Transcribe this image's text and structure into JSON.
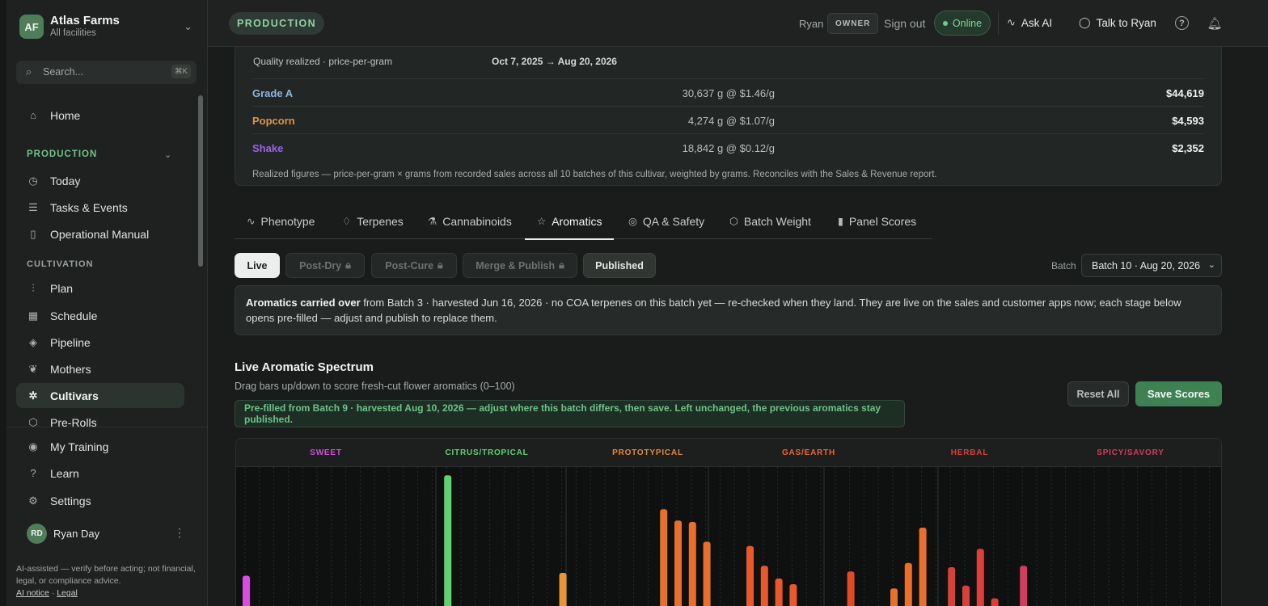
{
  "org": {
    "initials": "AF",
    "name": "Atlas Farms",
    "scope": "All facilities"
  },
  "search": {
    "placeholder": "Search...",
    "shortcut": "⌘K"
  },
  "nav": {
    "home": "Home",
    "production_section": "PRODUCTION",
    "today": "Today",
    "tasks": "Tasks & Events",
    "manual": "Operational Manual",
    "cultivation_section": "CULTIVATION",
    "plan": "Plan",
    "schedule": "Schedule",
    "pipeline": "Pipeline",
    "mothers": "Mothers",
    "cultivars": "Cultivars",
    "prerolls": "Pre-Rolls",
    "training": "My Training",
    "learn": "Learn",
    "settings": "Settings"
  },
  "user": {
    "initials": "RD",
    "name": "Ryan Day"
  },
  "disclaimer": {
    "text": "AI-assisted — verify before acting; not financial, legal, or compliance advice.",
    "ai_notice": "AI notice",
    "sep": "·",
    "legal": "Legal"
  },
  "topbar": {
    "context": "PRODUCTION",
    "user": "Ryan",
    "role": "OWNER",
    "signout": "Sign out",
    "status": "Online",
    "ask_ai": "Ask AI",
    "talk": "Talk to Ryan"
  },
  "revenue": {
    "header_label": "Quality realized · price-per-gram",
    "dates": "Oct 7, 2025 → Aug 20, 2026",
    "rows": [
      {
        "grade": "Grade A",
        "qty": "30,637 g @ $1.46/g",
        "total": "$44,619",
        "color": "#8fb6df"
      },
      {
        "grade": "Popcorn",
        "qty": "4,274 g @ $1.07/g",
        "total": "$4,593",
        "color": "#e0934a"
      },
      {
        "grade": "Shake",
        "qty": "18,842 g @ $0.12/g",
        "total": "$2,352",
        "color": "#9a63e8"
      }
    ],
    "note": "Realized figures — price-per-gram × grams from recorded sales across all 10 batches of this cultivar, weighted by grams. Reconciles with the Sales & Revenue report."
  },
  "tabs": [
    {
      "label": "Phenotype",
      "icon": "pulse-icon"
    },
    {
      "label": "Terpenes",
      "icon": "drop-icon"
    },
    {
      "label": "Cannabinoids",
      "icon": "flask-icon"
    },
    {
      "label": "Aromatics",
      "icon": "star-icon"
    },
    {
      "label": "QA & Safety",
      "icon": "check-circle-icon"
    },
    {
      "label": "Batch Weight",
      "icon": "box-icon"
    },
    {
      "label": "Panel Scores",
      "icon": "bar-chart-icon"
    }
  ],
  "stages": {
    "live": "Live",
    "postdry": "Post-Dry",
    "postcure": "Post-Cure",
    "merge": "Merge & Publish",
    "published": "Published"
  },
  "batch": {
    "label": "Batch",
    "selected": "Batch 10 · Aug 20, 2026"
  },
  "notice": {
    "bold": "Aromatics carried over",
    "text": " from Batch 3 · harvested Jun 16, 2026 · no COA terpenes on this batch yet — re-checked when they land. They are live on the sales and customer apps now; each stage below opens pre-filled — adjust and publish to replace them."
  },
  "spectrum": {
    "title": "Live Aromatic Spectrum",
    "subtitle": "Drag bars up/down to score fresh-cut flower aromatics (0–100)",
    "reset": "Reset All",
    "save": "Save Scores",
    "prefill": "Pre-filled from Batch 9 · harvested Aug 10, 2026 — adjust where this batch differs, then save. Left unchanged, the previous aromatics stay published.",
    "categories": [
      {
        "name": "SWEET",
        "color": "#d44fd8"
      },
      {
        "name": "CITRUS/TROPICAL",
        "color": "#5fd26e"
      },
      {
        "name": "PROTOTYPICAL",
        "color": "#e7873a"
      },
      {
        "name": "GAS/EARTH",
        "color": "#e46a36"
      },
      {
        "name": "HERBAL",
        "color": "#d9403c"
      },
      {
        "name": "SPICY/SAVORY",
        "color": "#d43d5e"
      }
    ],
    "scores": [
      {
        "slot": 0,
        "value": 26,
        "color": "#d84fe0"
      },
      {
        "slot": 14,
        "value": 97,
        "color": "#5fd26e"
      },
      {
        "slot": 22,
        "value": 28,
        "color": "#e8953a"
      },
      {
        "slot": 28,
        "value": 3,
        "color": "#e0783a"
      },
      {
        "slot": 29,
        "value": 73,
        "color": "#e8702f"
      },
      {
        "slot": 30,
        "value": 65,
        "color": "#e8702f"
      },
      {
        "slot": 31,
        "value": 64,
        "color": "#e8702f"
      },
      {
        "slot": 32,
        "value": 50,
        "color": "#e8702f"
      },
      {
        "slot": 35,
        "value": 47,
        "color": "#e85a2e"
      },
      {
        "slot": 36,
        "value": 33,
        "color": "#e85a2e"
      },
      {
        "slot": 37,
        "value": 24,
        "color": "#e85a2e"
      },
      {
        "slot": 38,
        "value": 20,
        "color": "#e85a2e"
      },
      {
        "slot": 39,
        "value": 4,
        "color": "#e85a2e"
      },
      {
        "slot": 42,
        "value": 29,
        "color": "#e04a2a"
      },
      {
        "slot": 45,
        "value": 17,
        "color": "#e8702f"
      },
      {
        "slot": 46,
        "value": 35,
        "color": "#e8702f"
      },
      {
        "slot": 47,
        "value": 60,
        "color": "#e8702f"
      },
      {
        "slot": 49,
        "value": 32,
        "color": "#d9403c"
      },
      {
        "slot": 50,
        "value": 19,
        "color": "#d9403c"
      },
      {
        "slot": 51,
        "value": 45,
        "color": "#d9403c"
      },
      {
        "slot": 52,
        "value": 10,
        "color": "#d9403c"
      },
      {
        "slot": 54,
        "value": 33,
        "color": "#d43d5e"
      }
    ]
  }
}
